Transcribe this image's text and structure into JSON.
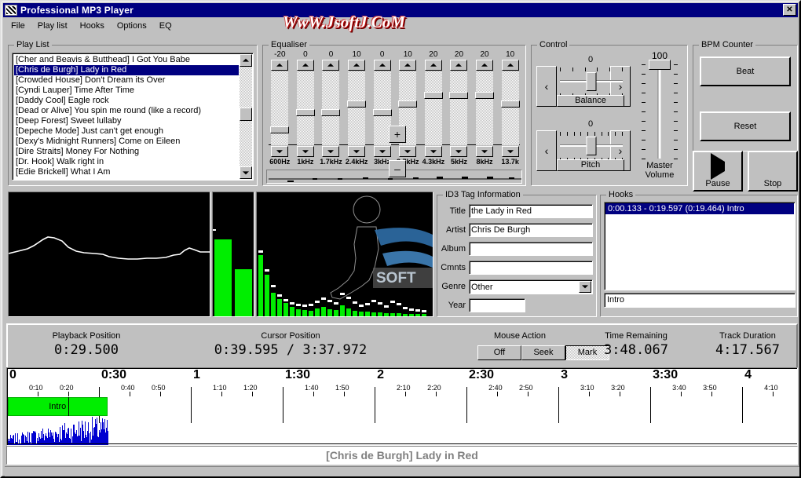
{
  "window": {
    "title": "Professional MP3 Player",
    "close_label": "✕",
    "watermark": "WwW.JsoftJ.CoM"
  },
  "menu": [
    {
      "label": "File"
    },
    {
      "label": "Play list"
    },
    {
      "label": "Hooks"
    },
    {
      "label": "Options"
    },
    {
      "label": "EQ"
    }
  ],
  "playlist": {
    "label": "Play List",
    "items": [
      {
        "text": "[Cher and Beavis & Butthead] I Got You Babe",
        "selected": false
      },
      {
        "text": "[Chris de Burgh] Lady in Red",
        "selected": true
      },
      {
        "text": "[Crowded House] Don't Dream its Over",
        "selected": false
      },
      {
        "text": "[Cyndi Lauper] Time After Time",
        "selected": false
      },
      {
        "text": "[Daddy Cool] Eagle rock",
        "selected": false
      },
      {
        "text": "[Dead or Alive] You spin me round (like a record)",
        "selected": false
      },
      {
        "text": "[Deep Forest] Sweet lullaby",
        "selected": false
      },
      {
        "text": "[Depeche Mode] Just can't get enough",
        "selected": false
      },
      {
        "text": "[Dexy's Midnight Runners] Come on Eileen",
        "selected": false
      },
      {
        "text": "[Dire Straits] Money For Nothing",
        "selected": false
      },
      {
        "text": "[Dr. Hook] Walk right in",
        "selected": false
      },
      {
        "text": "[Edie Brickell] What I Am",
        "selected": false
      }
    ]
  },
  "equaliser": {
    "label": "Equaliser",
    "plus_label": "+",
    "minus_label": "–",
    "bands": [
      {
        "value": "-20",
        "freq": "600Hz",
        "pct": -20
      },
      {
        "value": "0",
        "freq": "1kHz",
        "pct": 0
      },
      {
        "value": "0",
        "freq": "1.7kHz",
        "pct": 0
      },
      {
        "value": "10",
        "freq": "2.4kHz",
        "pct": 10
      },
      {
        "value": "0",
        "freq": "3kHz",
        "pct": 0
      },
      {
        "value": "10",
        "freq": "3.7kHz",
        "pct": 10
      },
      {
        "value": "20",
        "freq": "4.3kHz",
        "pct": 20
      },
      {
        "value": "20",
        "freq": "5kHz",
        "pct": 20
      },
      {
        "value": "20",
        "freq": "8kHz",
        "pct": 20
      },
      {
        "value": "10",
        "freq": "13.7k",
        "pct": 10
      }
    ]
  },
  "control": {
    "label": "Control",
    "balance": {
      "name": "Balance",
      "value": "0",
      "left_arrow": "‹",
      "right_arrow": "›"
    },
    "pitch": {
      "name": "Pitch",
      "value": "0",
      "left_arrow": "‹",
      "right_arrow": "›"
    },
    "master_volume": {
      "value": "100",
      "line1": "Master",
      "line2": "Volume"
    }
  },
  "bpm": {
    "label": "BPM Counter",
    "beat_label": "Beat",
    "reset_label": "Reset"
  },
  "transport": {
    "pause_label": "Pause",
    "stop_label": "Stop"
  },
  "id3": {
    "label": "ID3 Tag Information",
    "fields": [
      {
        "label": "Title",
        "value": "the Lady in Red"
      },
      {
        "label": "Artist",
        "value": "Chris De Burgh"
      },
      {
        "label": "Album",
        "value": ""
      },
      {
        "label": "Cmnts",
        "value": ""
      }
    ],
    "genre": {
      "label": "Genre",
      "value": "Other"
    },
    "year": {
      "label": "Year",
      "value": ""
    }
  },
  "hooks": {
    "label": "Hooks",
    "items": [
      {
        "text": "0:00.133 - 0:19.597 (0:19.464) Intro",
        "selected": true
      }
    ],
    "edit_value": "Intro"
  },
  "status": {
    "playback_position": {
      "caption": "Playback Position",
      "value": "0:29.500"
    },
    "cursor_position": {
      "caption": "Cursor Position",
      "value": "0:39.595 / 3:37.972"
    },
    "mouse_action": {
      "caption": "Mouse Action",
      "buttons": [
        {
          "label": "Off",
          "pressed": false
        },
        {
          "label": "Seek",
          "pressed": false
        },
        {
          "label": "Mark",
          "pressed": true
        }
      ]
    },
    "time_remaining": {
      "caption": "Time Remaining",
      "value": "3:48.067"
    },
    "track_duration": {
      "caption": "Track Duration",
      "value": "4:17.567"
    }
  },
  "timeline": {
    "major_ticks": [
      {
        "label": "0",
        "pct": 0.0
      },
      {
        "label": "0:30",
        "pct": 0.1165
      },
      {
        "label": "1",
        "pct": 0.2331
      },
      {
        "label": "1:30",
        "pct": 0.3496
      },
      {
        "label": "2",
        "pct": 0.4662
      },
      {
        "label": "2:30",
        "pct": 0.5827
      },
      {
        "label": "3",
        "pct": 0.6993
      },
      {
        "label": "3:30",
        "pct": 0.8158
      },
      {
        "label": "4",
        "pct": 0.9324
      }
    ],
    "minor_ticks": [
      {
        "label": "0:10",
        "pct": 0.0388
      },
      {
        "label": "0:20",
        "pct": 0.0777
      },
      {
        "label": "0:40",
        "pct": 0.1554
      },
      {
        "label": "0:50",
        "pct": 0.1942
      },
      {
        "label": "1:10",
        "pct": 0.2719
      },
      {
        "label": "1:20",
        "pct": 0.3108
      },
      {
        "label": "1:40",
        "pct": 0.3885
      },
      {
        "label": "1:50",
        "pct": 0.4273
      },
      {
        "label": "2:10",
        "pct": 0.505
      },
      {
        "label": "2:20",
        "pct": 0.5439
      },
      {
        "label": "2:40",
        "pct": 0.6216
      },
      {
        "label": "2:50",
        "pct": 0.6604
      },
      {
        "label": "3:10",
        "pct": 0.7381
      },
      {
        "label": "3:20",
        "pct": 0.777
      },
      {
        "label": "3:40",
        "pct": 0.8547
      },
      {
        "label": "3:50",
        "pct": 0.8935
      },
      {
        "label": "4:10",
        "pct": 0.9712
      }
    ],
    "hook_region": {
      "label": "Intro",
      "start_pct": 0.0005,
      "end_pct": 0.1275,
      "split_pct": 0.0777
    }
  },
  "now_playing": {
    "title": "[Chris de Burgh] Lady in Red"
  }
}
